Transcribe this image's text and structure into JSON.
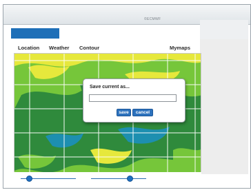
{
  "header": {
    "credit": "©ECMWF"
  },
  "menu": {
    "items": [
      "Location",
      "Weather",
      "Contour",
      "Mymaps"
    ]
  },
  "dialog": {
    "title": "Save current as...",
    "input_value": "",
    "save_label": "save",
    "cancel_label": "cancel"
  },
  "sliders": {
    "left_value": 0.15,
    "right_value": 0.7
  },
  "colors": {
    "accent": "#1e6fb8",
    "map_yellow": "#e6e83c",
    "map_light_green": "#76c63a",
    "map_dark_green": "#2f8a3c",
    "map_teal": "#1d8fb0"
  }
}
